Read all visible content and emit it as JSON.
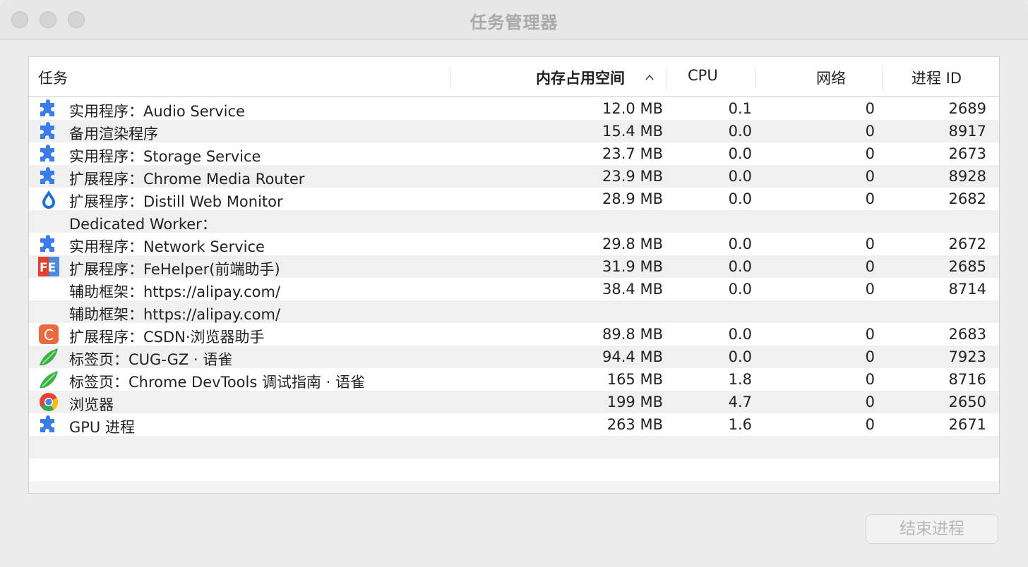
{
  "window": {
    "title": "任务管理器"
  },
  "table": {
    "headers": {
      "task": "任务",
      "memory": "内存占用空间",
      "cpu": "CPU",
      "network": "网络",
      "pid": "进程 ID"
    },
    "sort_column": "memory",
    "sort_direction": "ascending",
    "rows": [
      {
        "icon": "puzzle-icon",
        "task": "实用程序：Audio Service",
        "memory": "12.0 MB",
        "cpu": "0.1",
        "network": "0",
        "pid": "2689"
      },
      {
        "icon": "puzzle-icon",
        "task": "备用渲染程序",
        "memory": "15.4 MB",
        "cpu": "0.0",
        "network": "0",
        "pid": "8917"
      },
      {
        "icon": "puzzle-icon",
        "task": "实用程序：Storage Service",
        "memory": "23.7 MB",
        "cpu": "0.0",
        "network": "0",
        "pid": "2673"
      },
      {
        "icon": "puzzle-icon",
        "task": "扩展程序：Chrome Media Router",
        "memory": "23.9 MB",
        "cpu": "0.0",
        "network": "0",
        "pid": "8928"
      },
      {
        "icon": "droplet-icon",
        "task": "扩展程序：Distill Web Monitor",
        "memory": "28.9 MB",
        "cpu": "0.0",
        "network": "0",
        "pid": "2682"
      },
      {
        "icon": "",
        "task": "Dedicated Worker：",
        "memory": "",
        "cpu": "",
        "network": "",
        "pid": ""
      },
      {
        "icon": "puzzle-icon",
        "task": "实用程序：Network Service",
        "memory": "29.8 MB",
        "cpu": "0.0",
        "network": "0",
        "pid": "2672"
      },
      {
        "icon": "fe-logo-icon",
        "task": "扩展程序：FeHelper(前端助手)",
        "memory": "31.9 MB",
        "cpu": "0.0",
        "network": "0",
        "pid": "2685"
      },
      {
        "icon": "",
        "task": "辅助框架：https://alipay.com/",
        "memory": "38.4 MB",
        "cpu": "0.0",
        "network": "0",
        "pid": "8714"
      },
      {
        "icon": "",
        "task": "辅助框架：https://alipay.com/",
        "memory": "",
        "cpu": "",
        "network": "",
        "pid": ""
      },
      {
        "icon": "csdn-c-icon",
        "task": "扩展程序：CSDN·浏览器助手",
        "memory": "89.8 MB",
        "cpu": "0.0",
        "network": "0",
        "pid": "2683"
      },
      {
        "icon": "bird-icon",
        "task": "标签页：CUG-GZ · 语雀",
        "memory": "94.4 MB",
        "cpu": "0.0",
        "network": "0",
        "pid": "7923"
      },
      {
        "icon": "bird-icon",
        "task": "标签页：Chrome DevTools 调试指南 · 语雀",
        "memory": "165 MB",
        "cpu": "1.8",
        "network": "0",
        "pid": "8716"
      },
      {
        "icon": "chrome-icon",
        "task": "浏览器",
        "memory": "199 MB",
        "cpu": "4.7",
        "network": "0",
        "pid": "2650"
      },
      {
        "icon": "puzzle-icon",
        "task": "GPU 进程",
        "memory": "263 MB",
        "cpu": "1.6",
        "network": "0",
        "pid": "2671"
      }
    ]
  },
  "buttons": {
    "end_process": "结束进程"
  },
  "colors": {
    "puzzle": "#3b7de8",
    "droplet": "#1f6fd6",
    "fe_red": "#e0402e",
    "fe_blue": "#4a89dc",
    "csdn": "#e96a3f",
    "bird": "#36b34a"
  }
}
